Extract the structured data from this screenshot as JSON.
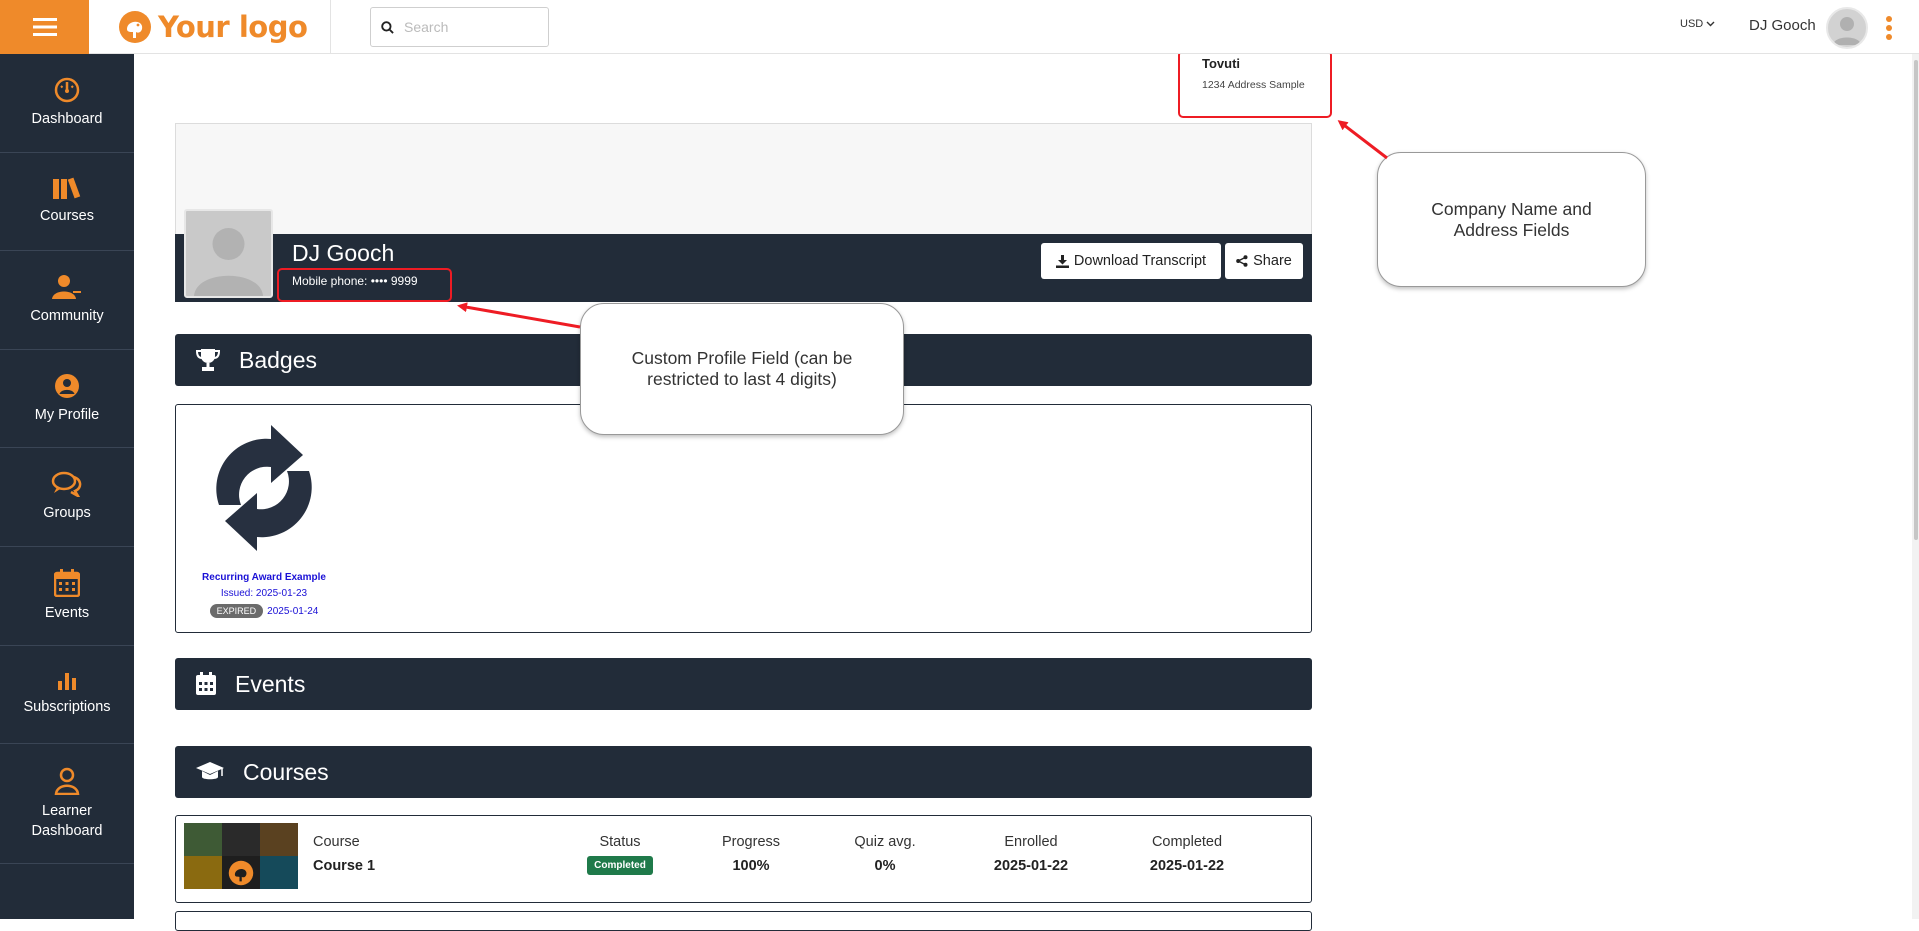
{
  "topbar": {
    "logo_your": "Your",
    "logo_logo": "logo",
    "search_placeholder": "Search",
    "currency": "USD",
    "user_name": "DJ Gooch"
  },
  "sidebar": {
    "items": [
      {
        "label": "Dashboard",
        "icon": "dashboard-icon"
      },
      {
        "label": "Courses",
        "icon": "books-icon"
      },
      {
        "label": "Community",
        "icon": "community-icon"
      },
      {
        "label": "My Profile",
        "icon": "user-circle-icon"
      },
      {
        "label": "Groups",
        "icon": "comments-icon"
      },
      {
        "label": "Events",
        "icon": "calendar-icon"
      },
      {
        "label": "Subscriptions",
        "icon": "bar-chart-icon"
      },
      {
        "label": "Learner Dashboard",
        "icon": "learner-icon"
      }
    ]
  },
  "company": {
    "name": "Tovuti",
    "address": "1234 Address Sample"
  },
  "profile": {
    "name": "DJ Gooch",
    "phone": "Mobile phone: •••• 9999",
    "download_label": "Download Transcript",
    "share_label": "Share"
  },
  "sections": {
    "badges": "Badges",
    "events": "Events",
    "courses": "Courses"
  },
  "badge": {
    "title": "Recurring Award Example",
    "issued": "Issued: 2025-01-23",
    "expired_label": "EXPIRED",
    "expired_date": "2025-01-24"
  },
  "course": {
    "col_course": "Course",
    "name": "Course 1",
    "col_status": "Status",
    "status": "Completed",
    "col_progress": "Progress",
    "progress": "100%",
    "col_quiz": "Quiz avg.",
    "quiz": "0%",
    "col_enrolled": "Enrolled",
    "enrolled": "2025-01-22",
    "col_completed": "Completed",
    "completed": "2025-01-22"
  },
  "annotations": {
    "company_callout": "Company Name and Address Fields",
    "custom_callout": "Custom Profile Field (can be restricted to last 4 digits)"
  },
  "colors": {
    "accent": "#ef8a2a",
    "navy": "#222c39",
    "annotation_red": "#ee1c24",
    "status_green": "#1f7a4a",
    "badge_link": "#1a10d6"
  }
}
